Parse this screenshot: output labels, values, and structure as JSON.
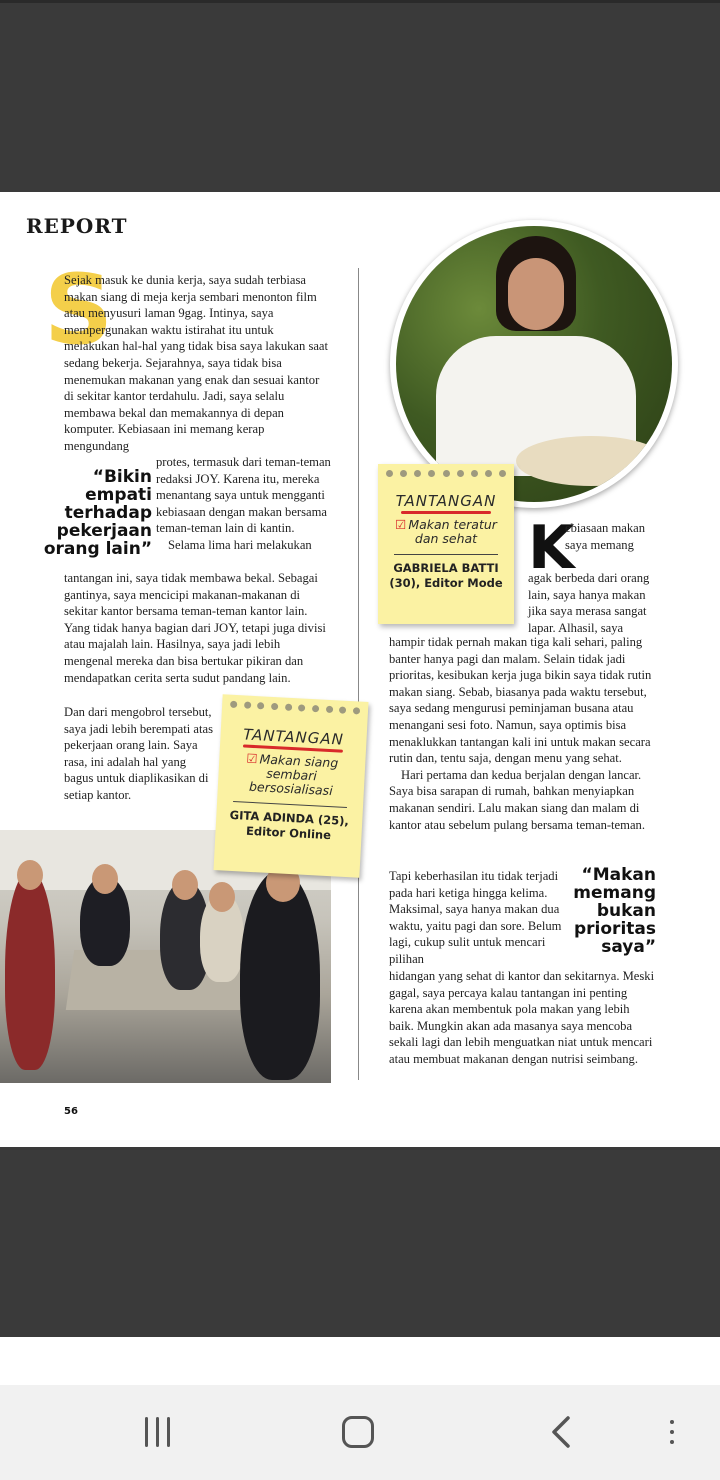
{
  "magazine": {
    "section_label": "REPORT",
    "page_number": "56",
    "dropcap_left": "S",
    "left_column": {
      "para1": "Sejak masuk ke dunia kerja, saya sudah terbiasa makan siang di meja kerja sembari menonton film atau menyusuri laman 9gag. Intinya, saya mempergunakan waktu istirahat itu untuk melakukan hal-hal yang tidak bisa saya lakukan saat sedang bekerja. Sejarahnya, saya tidak bisa menemukan makanan yang enak dan sesuai kantor di sekitar kantor terdahulu. Jadi, saya selalu membawa bekal dan memakannya di depan komputer. Kebiasaan ini memang kerap mengundang",
      "para2_wrap": "protes, termasuk dari teman-teman redaksi JOY. Karena itu, mereka menantang saya untuk mengganti kebiasaan dengan makan bersama teman-teman lain di kantin.",
      "para3_indent": "Selama lima hari melakukan",
      "para3": "tantangan ini, saya tidak membawa bekal. Sebagai gantinya, saya mencicipi makanan-makanan di sekitar kantor bersama teman-teman kantor lain. Yang tidak hanya bagian dari JOY, tetapi juga divisi atau majalah lain. Hasilnya, saya jadi lebih mengenal mereka dan bisa bertukar pikiran dan mendapatkan cerita serta sudut pandang lain.",
      "para4": "Dan dari mengobrol tersebut, saya jadi lebih berempati atas pekerjaan orang lain. Saya rasa, ini adalah hal yang bagus untuk diaplikasikan di setiap kantor."
    },
    "pull_quote_left": "“Bikin empati terhadap pekerjaan orang lain”",
    "note_right": {
      "title": "TANTANGAN",
      "item": "Makan teratur dan sehat",
      "name_line1": "GABRIELA BATTI",
      "name_line2": "(30), Editor Mode"
    },
    "note_left": {
      "title": "TANTANGAN",
      "item": "Makan siang sembari bersosialisasi",
      "name_line1": "GITA ADINDA (25),",
      "name_line2": "Editor Online"
    },
    "dropcap_right": "K",
    "right_column": {
      "k_wrap1": "ebiasaan makan saya memang",
      "k_wrap2": "agak berbeda dari orang lain, saya hanya makan jika saya merasa sangat lapar. Alhasil, saya",
      "para1": "hampir tidak pernah makan tiga kali sehari, paling banter hanya pagi dan malam. Selain tidak jadi prioritas, kesibukan kerja juga bikin saya tidak rutin makan siang. Sebab, biasanya pada waktu tersebut, saya sedang mengurusi peminjaman busana atau menangani sesi foto. Namun, saya optimis bisa menaklukkan tantangan kali ini untuk makan secara rutin dan, tentu saja, dengan menu yang sehat.",
      "para2": "Hari pertama dan kedua berjalan dengan lancar. Saya bisa sarapan di rumah, bahkan menyiapkan makanan sendiri. Lalu makan siang dan malam di kantor atau sebelum pulang bersama teman-teman.",
      "para3_wrap": "Tapi keberhasilan itu tidak terjadi pada hari ketiga hingga kelima. Maksimal, saya hanya makan dua waktu, yaitu pagi dan sore. Belum lagi, cukup sulit untuk mencari pilihan",
      "para3": "hidangan yang sehat di kantor dan sekitarnya. Meski gagal, saya percaya kalau tantangan ini penting karena akan membentuk pola makan yang lebih baik. Mungkin akan ada masanya saya mencoba sekali lagi dan lebih menguatkan niat untuk mencari atau membuat makanan dengan nutrisi seimbang."
    },
    "pull_quote_right": "“Makan memang bukan prioritas saya”"
  },
  "icons": {
    "check": "☑",
    "back": "‹"
  },
  "colors": {
    "accent_yellow": "#f4cf4a",
    "note_bg": "#fbf2a3",
    "check_red": "#d82a2a",
    "background": "#3a3a3a"
  }
}
